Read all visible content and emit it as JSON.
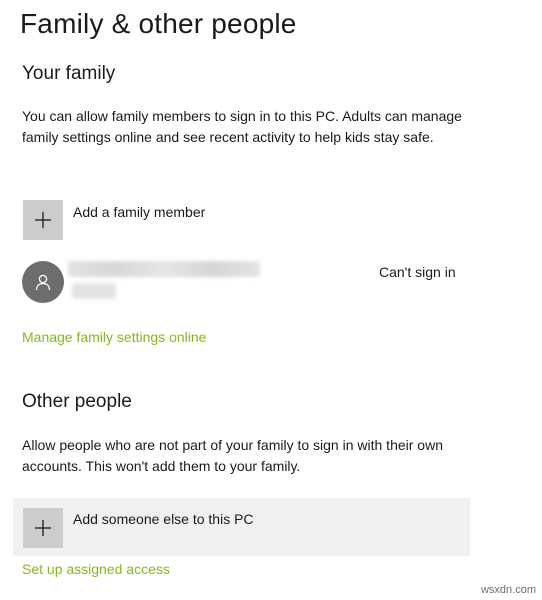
{
  "page": {
    "title": "Family & other people"
  },
  "family": {
    "heading": "Your family",
    "description": "You can allow family members to sign in to this PC. Adults can manage family settings online and see recent activity to help kids stay safe.",
    "add_label": "Add a family member",
    "add_icon": "plus-icon",
    "member": {
      "avatar_icon": "person-icon",
      "status": "Can't sign in"
    },
    "manage_link": "Manage family settings online"
  },
  "other": {
    "heading": "Other people",
    "description": "Allow people who are not part of your family to sign in with their own accounts. This won't add them to your family.",
    "add_label": "Add someone else to this PC",
    "add_icon": "plus-icon",
    "assigned_access_link": "Set up assigned access"
  },
  "watermark": "wsxdn.com",
  "colors": {
    "accent_link": "#86b81a",
    "tile_background": "#cccccc",
    "avatar_background": "#6d6d6d",
    "hover_row": "#f0f0f0"
  }
}
